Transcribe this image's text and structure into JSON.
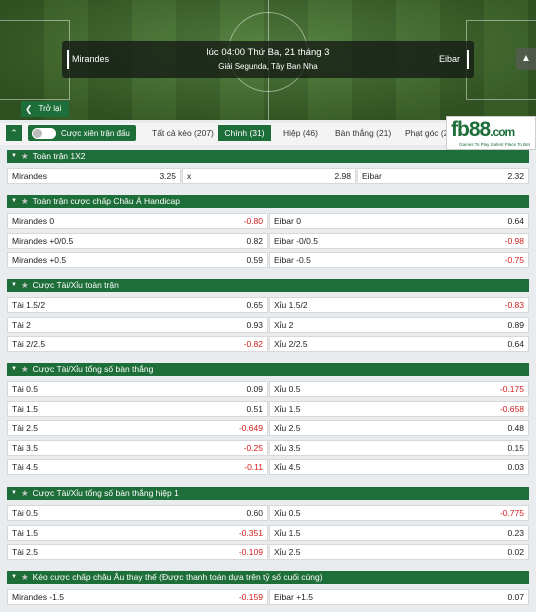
{
  "header": {
    "home_team": "Mirandes",
    "away_team": "Eibar",
    "time": "lúc 04:00 Thứ Ba, 21 tháng 3",
    "league": "Giải Segunda, Tây Ban Nha",
    "back_label": "Trở lại"
  },
  "tabs": {
    "parlay_label": "Cược xiên trận đấu",
    "items": [
      "Tất cả kèo (207)",
      "Chính (31)",
      "Hiệp (46)",
      "Bàn thắng (21)",
      "Phạt góc (27"
    ],
    "active": "Chính (31)"
  },
  "logo": {
    "brand": "fb88",
    "suffix": ".com",
    "tagline": "Games To Play     Safest Place To Bet"
  },
  "sections": [
    {
      "title": "Toàn trận 1X2",
      "rows": [
        [
          [
            "Mirandes",
            "3.25"
          ],
          [
            "x",
            "2.98"
          ],
          [
            "Eibar",
            "2.32"
          ]
        ]
      ]
    },
    {
      "title": "Toàn trận cược chấp Châu Á Handicap",
      "rows": [
        [
          [
            "Mirandes 0",
            "-0.80"
          ],
          [
            "Eibar 0",
            "0.64"
          ]
        ],
        [
          [
            "Mirandes +0/0.5",
            "0.82"
          ],
          [
            "Eibar -0/0.5",
            "-0.98"
          ]
        ],
        [
          [
            "Mirandes +0.5",
            "0.59"
          ],
          [
            "Eibar -0.5",
            "-0.75"
          ]
        ]
      ]
    },
    {
      "title": "Cược Tài/Xỉu toàn trận",
      "rows": [
        [
          [
            "Tài 1.5/2",
            "0.65"
          ],
          [
            "Xỉu 1.5/2",
            "-0.83"
          ]
        ],
        [
          [
            "Tài 2",
            "0.93"
          ],
          [
            "Xỉu 2",
            "0.89"
          ]
        ],
        [
          [
            "Tài 2/2.5",
            "-0.82"
          ],
          [
            "Xỉu 2/2.5",
            "0.64"
          ]
        ]
      ]
    },
    {
      "title": "Cược Tài/Xỉu tổng số bàn thắng",
      "rows": [
        [
          [
            "Tài 0.5",
            "0.09"
          ],
          [
            "Xỉu 0.5",
            "-0.175"
          ]
        ],
        [
          [
            "Tài 1.5",
            "0.51"
          ],
          [
            "Xỉu 1.5",
            "-0.658"
          ]
        ],
        [
          [
            "Tài 2.5",
            "-0.649"
          ],
          [
            "Xỉu 2.5",
            "0.48"
          ]
        ],
        [
          [
            "Tài 3.5",
            "-0.25"
          ],
          [
            "Xỉu 3.5",
            "0.15"
          ]
        ],
        [
          [
            "Tài 4.5",
            "-0.11"
          ],
          [
            "Xỉu 4.5",
            "0.03"
          ]
        ]
      ]
    },
    {
      "title": "Cược Tài/Xỉu tổng số bàn thắng hiệp 1",
      "rows": [
        [
          [
            "Tài 0.5",
            "0.60"
          ],
          [
            "Xỉu 0.5",
            "-0.775"
          ]
        ],
        [
          [
            "Tài 1.5",
            "-0.351"
          ],
          [
            "Xỉu 1.5",
            "0.23"
          ]
        ],
        [
          [
            "Tài 2.5",
            "-0.109"
          ],
          [
            "Xỉu 2.5",
            "0.02"
          ]
        ]
      ]
    },
    {
      "title": "Kèo cược chấp châu Âu thay thế (Được thanh toán dựa trên tỷ số cuối cùng)",
      "rows": [
        [
          [
            "Mirandes -1.5",
            "-0.159"
          ],
          [
            "Eibar +1.5",
            "0.07"
          ]
        ]
      ]
    }
  ],
  "colors": {
    "brand_green": "#1e6e3a",
    "negative_odd": "#d51b1b"
  }
}
